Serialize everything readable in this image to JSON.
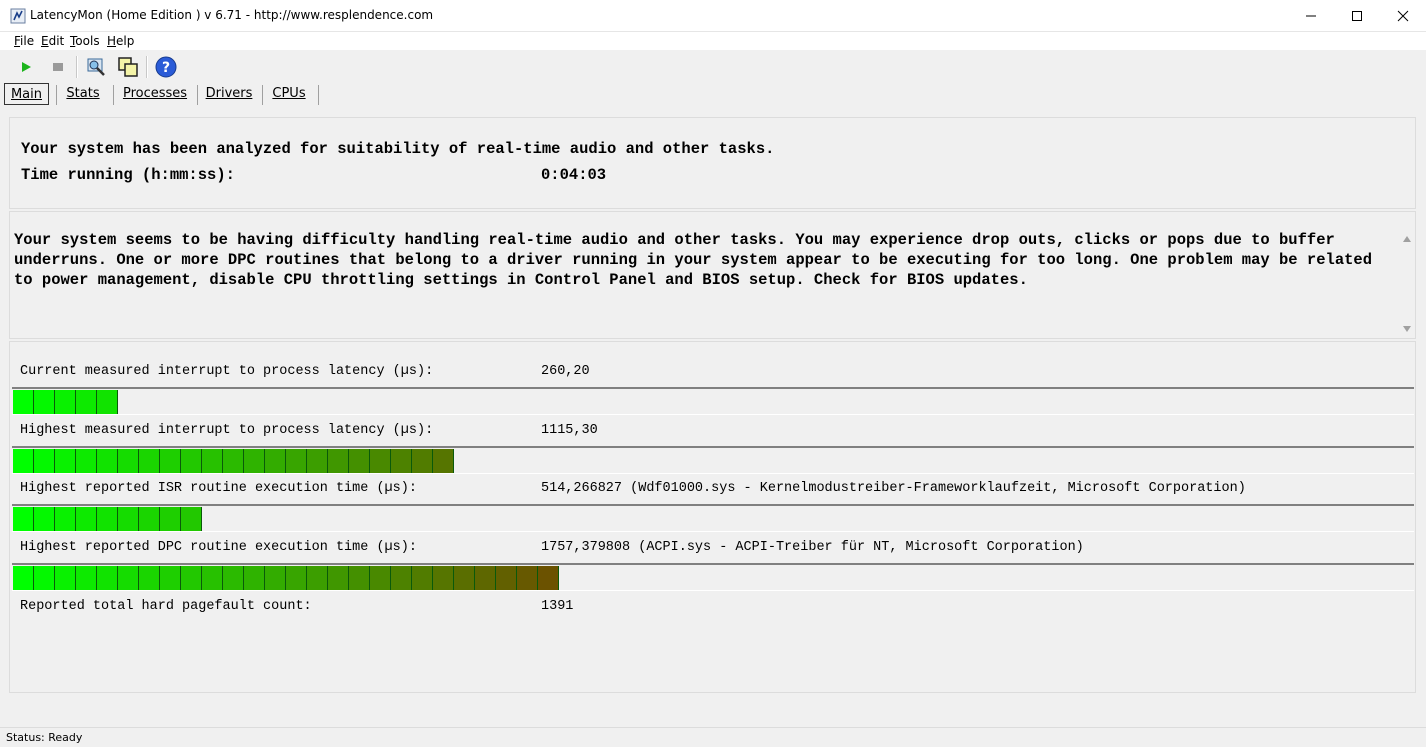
{
  "window": {
    "title": "LatencyMon  (Home Edition )  v 6.71 - http://www.resplendence.com"
  },
  "menu": {
    "items": [
      {
        "prefix": "",
        "underline": "F",
        "rest": "ile"
      },
      {
        "prefix": "",
        "underline": "E",
        "rest": "dit"
      },
      {
        "prefix": "",
        "underline": "T",
        "rest": "ools"
      },
      {
        "prefix": "",
        "underline": "H",
        "rest": "elp"
      }
    ]
  },
  "toolbar": {
    "icons": [
      "play-icon",
      "stop-icon",
      "analyze-icon",
      "windows-icon",
      "help-icon"
    ]
  },
  "tabs": [
    {
      "label": "Main",
      "active": true
    },
    {
      "label": "Stats",
      "active": false
    },
    {
      "label": "Processes",
      "active": false
    },
    {
      "label": "Drivers",
      "active": false
    },
    {
      "label": "CPUs",
      "active": false
    }
  ],
  "summary": {
    "headline": "Your system has been analyzed for suitability of real-time audio and other tasks.",
    "time_label": "Time running (h:mm:ss):",
    "time_value": "0:04:03"
  },
  "message": {
    "text": "Your system seems to be having difficulty handling real-time audio and other tasks. You may experience drop outs, clicks or pops due to buffer underruns. One or more DPC routines that belong to a driver running in your system appear to be executing for too long. One problem may be related to power management, disable CPU throttling settings in Control Panel and BIOS setup. Check for BIOS updates."
  },
  "metrics": [
    {
      "label": "Current measured interrupt to process latency (µs):",
      "value": "260,20",
      "segments": 5
    },
    {
      "label": "Highest measured interrupt to process latency (µs):",
      "value": "1115,30",
      "segments": 21
    },
    {
      "label": "Highest reported ISR routine execution time (µs):",
      "value": "514,266827  (Wdf01000.sys - Kernelmodustreiber-Frameworklaufzeit, Microsoft Corporation)",
      "segments": 9
    },
    {
      "label": "Highest reported DPC routine execution time (µs):",
      "value": "1757,379808  (ACPI.sys - ACPI-Treiber für NT, Microsoft Corporation)",
      "segments": 26
    }
  ],
  "pagefault": {
    "label": "Reported total hard pagefault count:",
    "value": "1391"
  },
  "status": {
    "text": "Status: Ready"
  },
  "colors": {
    "bar_start": "#00ff00",
    "bar_end": "#6b5200"
  }
}
